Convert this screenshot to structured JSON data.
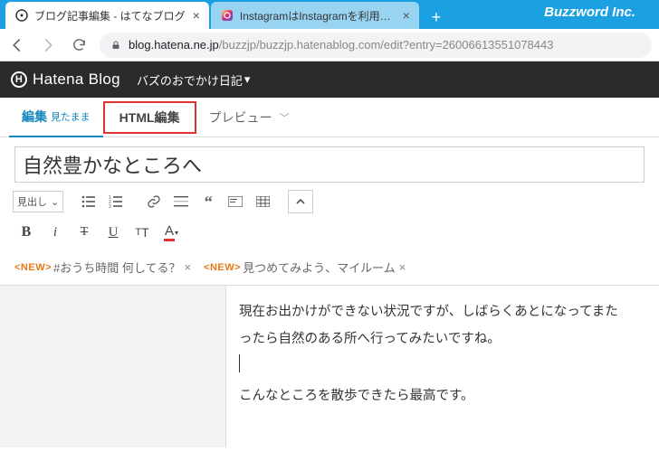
{
  "brand": "Buzzword Inc.",
  "browserTabs": [
    {
      "title": "ブログ記事編集 - はてなブログ",
      "active": true
    },
    {
      "title": "InstagramはInstagramを利用してい",
      "active": false
    }
  ],
  "url": {
    "host": "blog.hatena.ne.jp",
    "path": "/buzzjp/buzzjp.hatenablog.com/edit?entry=26006613551078443"
  },
  "hatena": {
    "logo": "Hatena Blog",
    "blogName": "バズのおでかけ日記"
  },
  "editTabs": {
    "compose": "編集",
    "composeSub": "見たまま",
    "html": "HTML編集",
    "preview": "プレビュー"
  },
  "postTitle": "自然豊かなところへ",
  "headingSelect": "見出し",
  "tags": [
    {
      "new": "<NEW>",
      "text": "#おうち時間 何してる？"
    },
    {
      "new": "<NEW>",
      "text": "見つめてみよう、マイルーム"
    }
  ],
  "body": {
    "p1": "現在お出かけができない状況ですが、しばらくあとになってまた",
    "p2": "ったら自然のある所へ行ってみたいですね。",
    "p3": "こんなところを散歩できたら最高です。"
  }
}
